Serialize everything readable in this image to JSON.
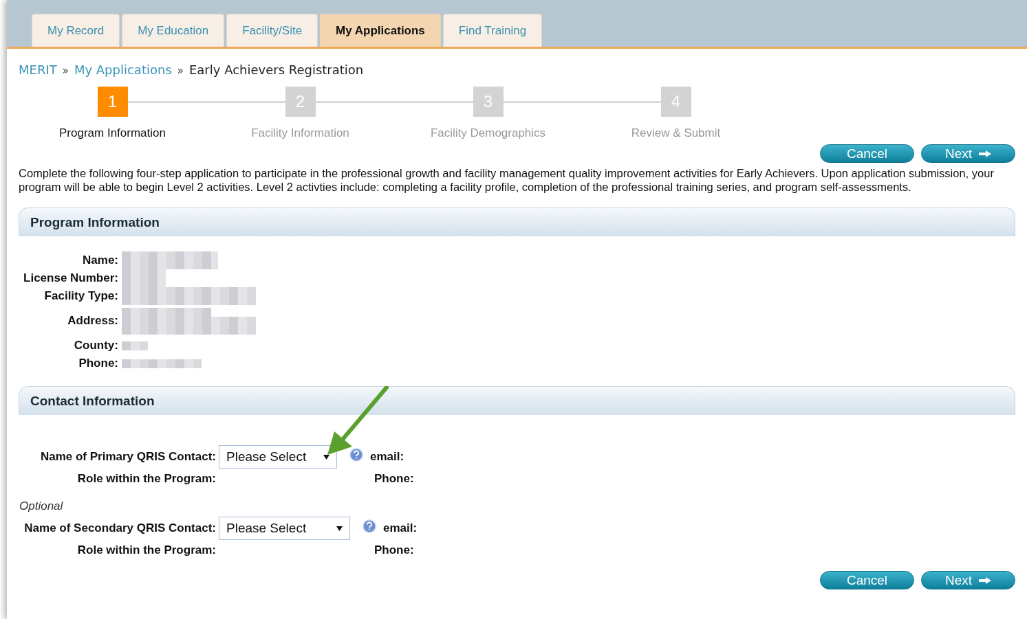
{
  "tabs": [
    {
      "label": "My Record",
      "selected": false
    },
    {
      "label": "My Education",
      "selected": false
    },
    {
      "label": "Facility/Site",
      "selected": false
    },
    {
      "label": "My Applications",
      "selected": true
    },
    {
      "label": "Find Training",
      "selected": false
    }
  ],
  "breadcrumb": [
    {
      "label": "MERIT",
      "kind": "link"
    },
    {
      "label": "»",
      "kind": "sep"
    },
    {
      "label": "My Applications",
      "kind": "link"
    },
    {
      "label": "»",
      "kind": "sep"
    },
    {
      "label": "Early Achievers Registration",
      "kind": "current"
    }
  ],
  "steps": [
    {
      "number": "1",
      "label": "Program Information",
      "selected": true
    },
    {
      "number": "2",
      "label": "Facility Information",
      "selected": false
    },
    {
      "number": "3",
      "label": "Facility Demographics",
      "selected": false
    },
    {
      "number": "4",
      "label": "Review & Submit",
      "selected": false
    }
  ],
  "buttons": {
    "cancel": "Cancel",
    "next": "Next"
  },
  "intro": "Complete the following four-step application to participate in the professional growth and facility management quality improvement activities for Early Achievers. Upon application submission, your program will be able to begin Level 2 activities. Level 2 activties include: completing a facility profile, completion of the professional training series, and program self-assessments.",
  "program_section": {
    "title": "Program Information",
    "fields": [
      {
        "label": "Name:"
      },
      {
        "label": "License Number:"
      },
      {
        "label": "Facility Type:"
      },
      {
        "label": "Address:",
        "kind": "tall"
      },
      {
        "label": "County:"
      },
      {
        "label": "Phone:"
      }
    ]
  },
  "contact_section": {
    "title": "Contact Information",
    "contacts": [
      {
        "label": "Name of Primary QRIS Contact:",
        "select": "Please Select",
        "email_label": "email:",
        "role_label": "Role within the Program:",
        "phone_label": "Phone:"
      },
      {
        "note": "Optional",
        "label": "Name of Secondary QRIS Contact:",
        "select": "Please Select",
        "email_label": "email:",
        "role_label": "Role within the Program:",
        "phone_label": "Phone:"
      }
    ]
  },
  "bottom_buttons": {
    "cancel": "Cancel",
    "next": "Next"
  }
}
